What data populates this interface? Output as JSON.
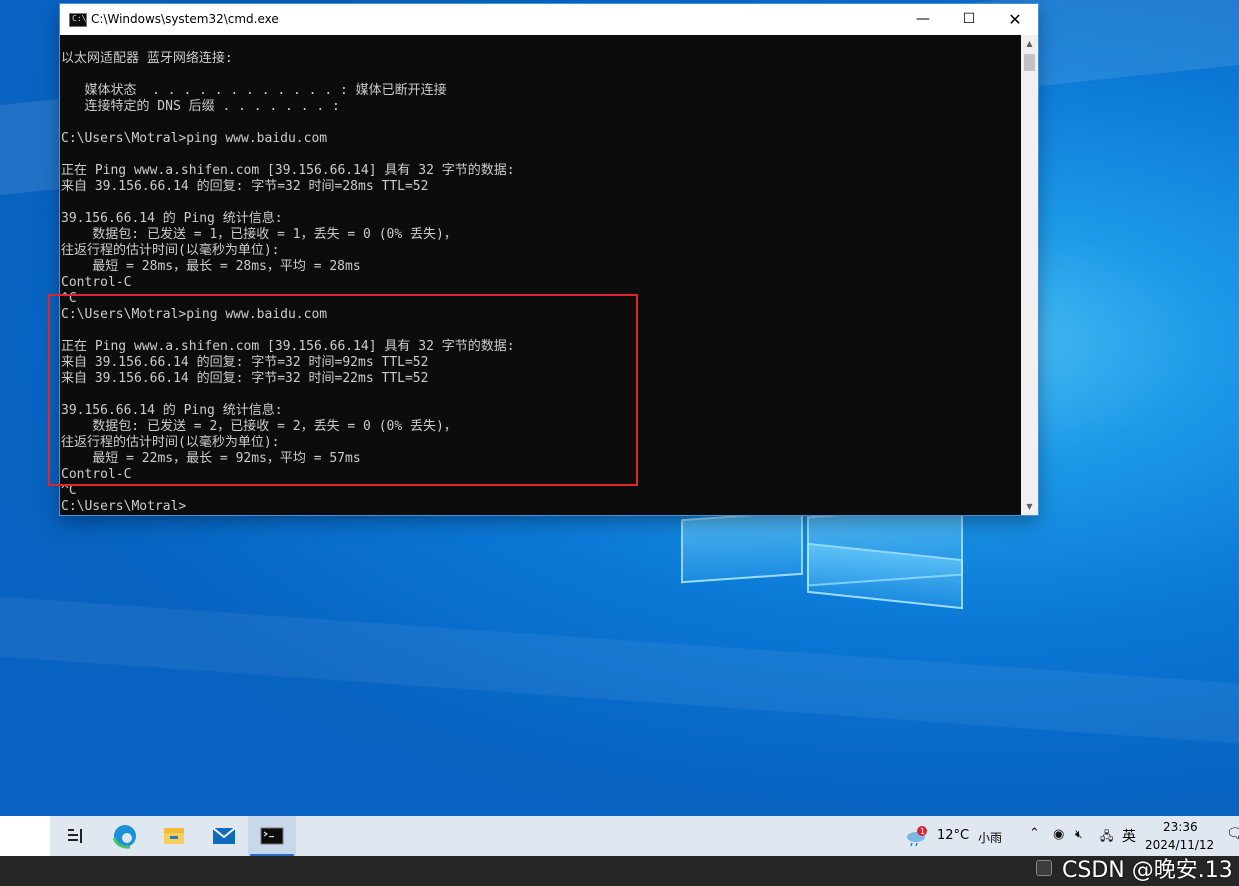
{
  "window": {
    "title": "C:\\Windows\\system32\\cmd.exe",
    "minimize_glyph": "—",
    "maximize_glyph": "☐",
    "close_glyph": "✕"
  },
  "console": {
    "lines": [
      "以太网适配器 蓝牙网络连接:",
      "",
      "   媒体状态  . . . . . . . . . . . . : 媒体已断开连接",
      "   连接特定的 DNS 后缀 . . . . . . . :",
      "",
      "C:\\Users\\Motral>ping www.baidu.com",
      "",
      "正在 Ping www.a.shifen.com [39.156.66.14] 具有 32 字节的数据:",
      "来自 39.156.66.14 的回复: 字节=32 时间=28ms TTL=52",
      "",
      "39.156.66.14 的 Ping 统计信息:",
      "    数据包: 已发送 = 1，已接收 = 1，丢失 = 0 (0% 丢失)，",
      "往返行程的估计时间(以毫秒为单位):",
      "    最短 = 28ms，最长 = 28ms，平均 = 28ms",
      "Control-C",
      "^C",
      "C:\\Users\\Motral>ping www.baidu.com",
      "",
      "正在 Ping www.a.shifen.com [39.156.66.14] 具有 32 字节的数据:",
      "来自 39.156.66.14 的回复: 字节=32 时间=92ms TTL=52",
      "来自 39.156.66.14 的回复: 字节=32 时间=22ms TTL=52",
      "",
      "39.156.66.14 的 Ping 统计信息:",
      "    数据包: 已发送 = 2，已接收 = 2，丢失 = 0 (0% 丢失)，",
      "往返行程的估计时间(以毫秒为单位):",
      "    最短 = 22ms，最长 = 92ms，平均 = 57ms",
      "Control-C",
      "^C",
      "C:\\Users\\Motral>"
    ]
  },
  "taskbar": {
    "weather_badge": "1",
    "temperature": "12°C",
    "condition": "小雨",
    "ime": "英",
    "time": "23:36",
    "date": "2024/11/12"
  },
  "watermark": "CSDN @晚安.13",
  "colors": {
    "console_bg": "#0c0c0c",
    "console_fg": "#cccccc",
    "highlight": "#e0262c",
    "taskbar_bg": "#dfe7f1"
  }
}
